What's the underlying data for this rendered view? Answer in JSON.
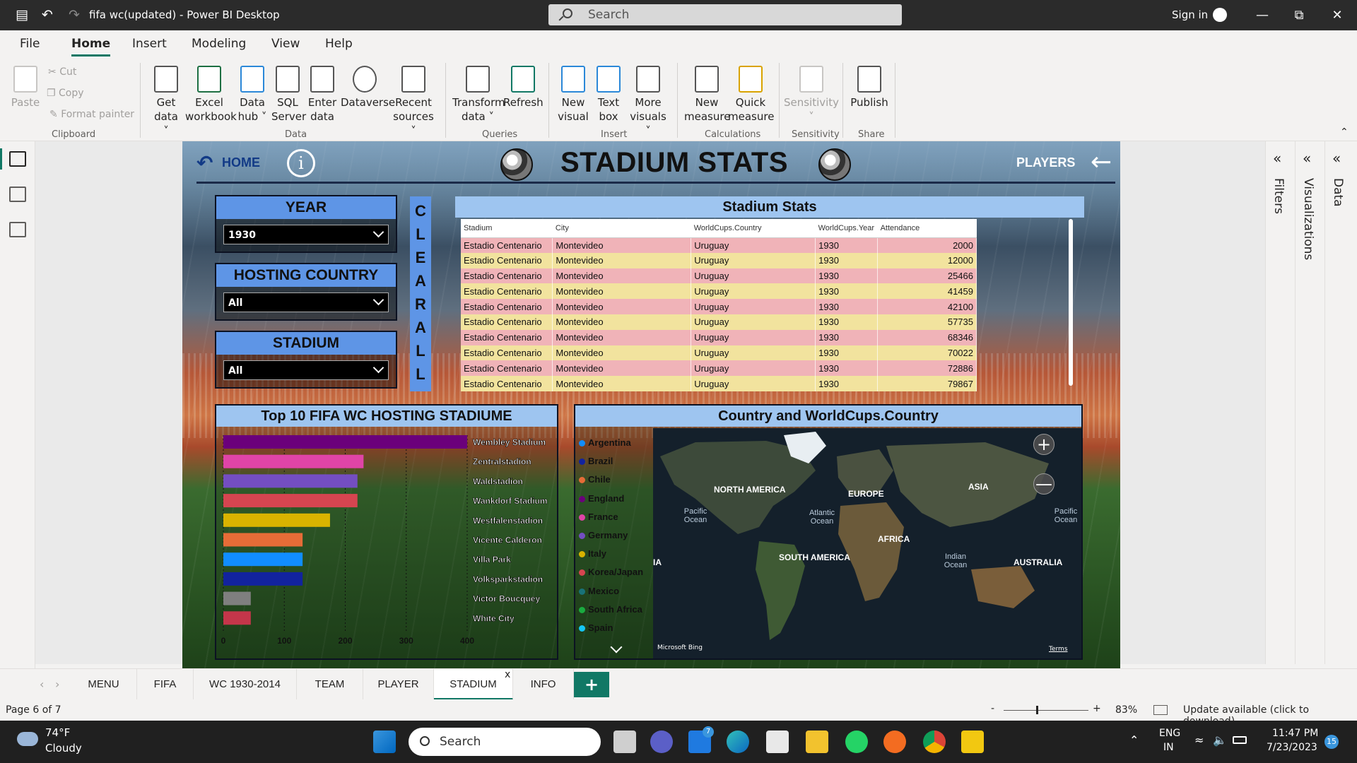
{
  "window": {
    "title": "fifa wc(updated) - Power BI Desktop",
    "search_placeholder": "Search",
    "sign_in": "Sign in"
  },
  "menu": {
    "tabs": [
      "File",
      "Home",
      "Insert",
      "Modeling",
      "View",
      "Help"
    ],
    "active": "Home"
  },
  "ribbon": {
    "clipboard": {
      "paste": "Paste",
      "cut": "Cut",
      "copy": "Copy",
      "format_painter": "Format painter",
      "group": "Clipboard"
    },
    "data": {
      "get_data": [
        "Get",
        "data"
      ],
      "excel": [
        "Excel",
        "workbook"
      ],
      "data_hub": [
        "Data",
        "hub"
      ],
      "sql": [
        "SQL",
        "Server"
      ],
      "enter": [
        "Enter",
        "data"
      ],
      "dataverse": [
        "Dataverse",
        ""
      ],
      "recent": [
        "Recent",
        "sources"
      ],
      "group": "Data"
    },
    "queries": {
      "transform": [
        "Transform",
        "data"
      ],
      "refresh": [
        "Refresh",
        ""
      ],
      "group": "Queries"
    },
    "insert": {
      "new_visual": [
        "New",
        "visual"
      ],
      "text_box": [
        "Text",
        "box"
      ],
      "more_visuals": [
        "More",
        "visuals"
      ],
      "group": "Insert"
    },
    "calculations": {
      "new_measure": [
        "New",
        "measure"
      ],
      "quick_measure": [
        "Quick",
        "measure"
      ],
      "group": "Calculations"
    },
    "sensitivity": {
      "label": "Sensitivity",
      "group": "Sensitivity"
    },
    "share": {
      "publish": "Publish",
      "group": "Share"
    }
  },
  "report": {
    "home": "HOME",
    "info": "i",
    "title": "STADIUM STATS",
    "players": "PLAYERS",
    "slicers": {
      "year": {
        "title": "YEAR",
        "value": "1930"
      },
      "hosting_country": {
        "title": "HOSTING COUNTRY",
        "value": "All"
      },
      "stadium": {
        "title": "STADIUM",
        "value": "All"
      }
    },
    "clear_all": [
      "C",
      "L",
      "E",
      "A",
      "R",
      "A",
      "L",
      "L"
    ],
    "table": {
      "title": "Stadium Stats",
      "columns": [
        "Stadium",
        "City",
        "WorldCups.Country",
        "WorldCups.Year",
        "Attendance"
      ],
      "rows": [
        [
          "Estadio Centenario",
          "Montevideo",
          "Uruguay",
          "1930",
          "2000"
        ],
        [
          "Estadio Centenario",
          "Montevideo",
          "Uruguay",
          "1930",
          "12000"
        ],
        [
          "Estadio Centenario",
          "Montevideo",
          "Uruguay",
          "1930",
          "25466"
        ],
        [
          "Estadio Centenario",
          "Montevideo",
          "Uruguay",
          "1930",
          "41459"
        ],
        [
          "Estadio Centenario",
          "Montevideo",
          "Uruguay",
          "1930",
          "42100"
        ],
        [
          "Estadio Centenario",
          "Montevideo",
          "Uruguay",
          "1930",
          "57735"
        ],
        [
          "Estadio Centenario",
          "Montevideo",
          "Uruguay",
          "1930",
          "68346"
        ],
        [
          "Estadio Centenario",
          "Montevideo",
          "Uruguay",
          "1930",
          "70022"
        ],
        [
          "Estadio Centenario",
          "Montevideo",
          "Uruguay",
          "1930",
          "72886"
        ],
        [
          "Estadio Centenario",
          "Montevideo",
          "Uruguay",
          "1930",
          "79867"
        ]
      ]
    },
    "map": {
      "title": "Country and WorldCups.Country",
      "legend": [
        {
          "name": "Argentina",
          "color": "#118dff"
        },
        {
          "name": "Brazil",
          "color": "#12239e"
        },
        {
          "name": "Chile",
          "color": "#e66c37"
        },
        {
          "name": "England",
          "color": "#6b007b"
        },
        {
          "name": "France",
          "color": "#e044a7"
        },
        {
          "name": "Germany",
          "color": "#744ec2"
        },
        {
          "name": "Italy",
          "color": "#d9b300"
        },
        {
          "name": "Korea/Japan",
          "color": "#d64550"
        },
        {
          "name": "Mexico",
          "color": "#197278"
        },
        {
          "name": "South Africa",
          "color": "#1aab40"
        },
        {
          "name": "Spain",
          "color": "#15c6f4"
        }
      ],
      "continents": [
        "NORTH AMERICA",
        "EUROPE",
        "ASIA",
        "AFRICA",
        "SOUTH AMERICA",
        "AUSTRALIA",
        "IA"
      ],
      "oceans": [
        "Pacific Ocean",
        "Atlantic Ocean",
        "Indian Ocean",
        "Pacific Ocean"
      ],
      "attribution": "Microsoft Bing",
      "terms": "Terms",
      "zoom_in": "+",
      "zoom_out": "—"
    }
  },
  "chart_data": {
    "type": "bar",
    "title": "Top 10 FIFA WC HOSTING STADIUME",
    "categories": [
      "Wembley Stadium",
      "Zentralstadion",
      "Waldstadion",
      "Wankdorf Stadium",
      "Westfalenstadion",
      "Vicente Calderon",
      "Villa Park",
      "Volksparkstadion",
      "Victor Boucquey",
      "White City"
    ],
    "values": [
      400,
      230,
      220,
      220,
      175,
      130,
      130,
      130,
      45,
      45
    ],
    "colors": [
      "#6b007b",
      "#e044a7",
      "#744ec2",
      "#d64550",
      "#d9b300",
      "#e66c37",
      "#118dff",
      "#12239e",
      "#7f7f7f",
      "#c4364a"
    ],
    "xlim": [
      0,
      400
    ],
    "ticks": [
      "0",
      "100",
      "200",
      "300",
      "400"
    ]
  },
  "pages": {
    "tabs": [
      "MENU",
      "FIFA",
      "WC 1930-2014",
      "TEAM",
      "PLAYER",
      "STADIUM",
      "INFO"
    ],
    "active": "STADIUM",
    "close": "x",
    "add": "+"
  },
  "panes": {
    "filters": "Filters",
    "visualizations": "Visualizations",
    "data": "Data"
  },
  "status": {
    "page": "Page 6 of 7",
    "zoom": "83%",
    "update": "Update available (click to download)",
    "zoom_minus": "-",
    "zoom_plus": "+"
  },
  "taskbar": {
    "weather_temp": "74°F",
    "weather_desc": "Cloudy",
    "search": "Search",
    "lang1": "ENG",
    "lang2": "IN",
    "time": "11:47 PM",
    "date": "7/23/2023",
    "notif": "15",
    "mail_badge": "7"
  }
}
